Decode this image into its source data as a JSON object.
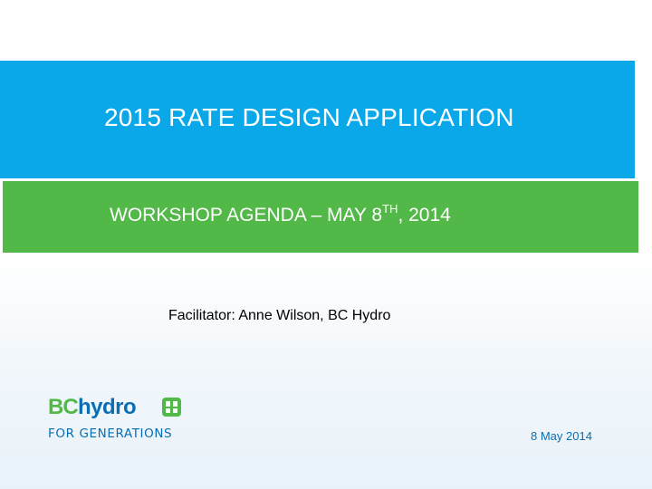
{
  "slide": {
    "title": "2015 RATE DESIGN APPLICATION",
    "subtitle_main": "WORKSHOP AGENDA – MAY 8",
    "subtitle_sup": "TH",
    "subtitle_tail": ", 2014",
    "facilitator": "Facilitator: Anne Wilson, BC Hydro",
    "date": "8 May 2014"
  },
  "logo": {
    "bc": "BC",
    "hydro": "hydro",
    "tagline": "FOR GENERATIONS",
    "mark_icon": "bchydro-mark-icon"
  },
  "colors": {
    "title_band": "#0aa8e8",
    "subtitle_band": "#52b848",
    "brand_blue": "#0a6eb4",
    "brand_green": "#52b848"
  }
}
